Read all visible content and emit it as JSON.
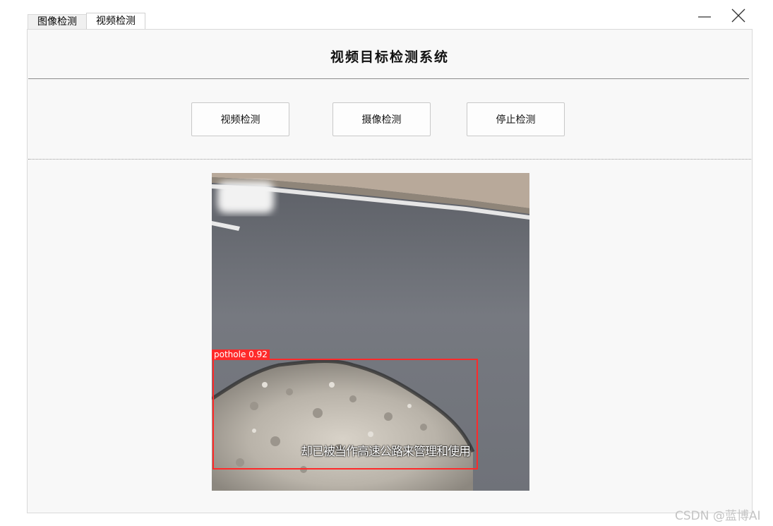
{
  "tabs": [
    {
      "label": "图像检测"
    },
    {
      "label": "视频检测"
    }
  ],
  "window": {
    "minimize_icon": "minimize-icon",
    "close_icon": "close-icon"
  },
  "main": {
    "title": "视频目标检测系统",
    "buttons": {
      "video_detect": "视频检测",
      "camera_detect": "摄像检测",
      "stop_detect": "停止检测"
    },
    "video_frame": {
      "detection_label": "pothole 0.92",
      "subtitle": "却已被当作高速公路来管理和使用",
      "box_color": "#ff2a2a"
    }
  },
  "watermark": "CSDN @蓝博AI"
}
